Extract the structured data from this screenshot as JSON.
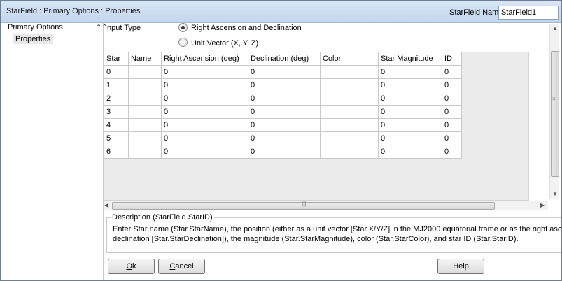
{
  "window": {
    "title": "StarField : Primary Options : Properties",
    "name_label": "StarField Name",
    "name_value": "StarField1"
  },
  "nav": {
    "root": "Primary Options",
    "child": "Properties"
  },
  "input_type": {
    "label": "Input Type",
    "options": [
      "Right Ascension and Declination",
      "Unit Vector (X, Y, Z)"
    ],
    "selected": "Right Ascension and Declination"
  },
  "table": {
    "columns": [
      "Star",
      "Name",
      "Right Ascension (deg)",
      "Declination (deg)",
      "Color",
      "Star Magnitude",
      "ID"
    ],
    "rows": [
      [
        "0",
        "",
        "0",
        "0",
        "",
        "0",
        "0"
      ],
      [
        "1",
        "",
        "0",
        "0",
        "",
        "0",
        "0"
      ],
      [
        "2",
        "",
        "0",
        "0",
        "",
        "0",
        "0"
      ],
      [
        "3",
        "",
        "0",
        "0",
        "",
        "0",
        "0"
      ],
      [
        "4",
        "",
        "0",
        "0",
        "",
        "0",
        "0"
      ],
      [
        "5",
        "",
        "0",
        "0",
        "",
        "0",
        "0"
      ],
      [
        "6",
        "",
        "0",
        "0",
        "",
        "0",
        "0"
      ]
    ]
  },
  "description": {
    "title": "Description (StarField.StarID)",
    "line1": "Enter Star name (Star.StarName), the position (either as a unit vector [Star.X/Y/Z] in the MJ2000 equatorial frame or as the right ascension [Star.StarRight",
    "line2": "declination [Star.StarDeclination]), the magnitude (Star.StarMagnitude), color (Star.StarColor), and star ID (Star.StarID)."
  },
  "buttons": {
    "ok": "Ok",
    "cancel": "Cancel",
    "help": "Help"
  },
  "icons": {
    "collapse": "double-chevron-up-icon",
    "scroll_up": "arrow-up-icon",
    "scroll_down": "arrow-down-icon",
    "scroll_left": "arrow-left-icon",
    "scroll_right": "arrow-right-icon"
  }
}
